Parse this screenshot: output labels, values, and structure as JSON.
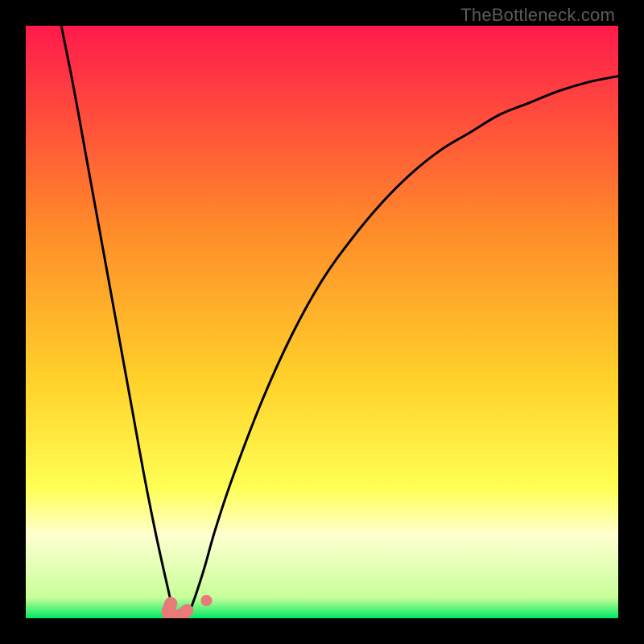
{
  "watermark": "TheBottleneck.com",
  "gradient": {
    "top_color": "#ff1a4b",
    "mid1_color": "#ff8a2a",
    "mid2_color": "#ffd22a",
    "mid3_color": "#ffff55",
    "pale_band": "#ffffd0",
    "bottom_color": "#00e862"
  },
  "marker": {
    "color": "#e87a7a",
    "stroke": "#d86a6a"
  },
  "chart_data": {
    "type": "line",
    "title": "",
    "xlabel": "",
    "ylabel": "",
    "xlim": [
      0,
      100
    ],
    "ylim": [
      0,
      100
    ],
    "grid": false,
    "legend": false,
    "series": [
      {
        "name": "left-curve",
        "x": [
          6,
          8,
          10,
          12,
          14,
          16,
          18,
          20,
          22,
          24,
          25,
          26
        ],
        "y": [
          100,
          90,
          79,
          68,
          57,
          46,
          35,
          24,
          14,
          5,
          1,
          0
        ]
      },
      {
        "name": "right-curve",
        "x": [
          27,
          28,
          30,
          32,
          35,
          40,
          45,
          50,
          55,
          60,
          65,
          70,
          75,
          80,
          85,
          90,
          95,
          100
        ],
        "y": [
          0,
          2,
          8,
          15,
          24,
          37,
          48,
          57,
          64,
          70,
          75,
          79,
          82,
          85,
          87,
          89,
          90.5,
          91.5
        ]
      }
    ],
    "marker_points": [
      {
        "x": 24.5,
        "y": 2.5
      },
      {
        "x": 24.0,
        "y": 1.2
      },
      {
        "x": 24.2,
        "y": 0.4
      },
      {
        "x": 25.2,
        "y": 0.3
      },
      {
        "x": 26.3,
        "y": 0.5
      },
      {
        "x": 27.2,
        "y": 1.3
      },
      {
        "x": 30.5,
        "y": 3.0
      }
    ],
    "background_gradient_stops": [
      {
        "pos": 0.0,
        "color": "#ff1a4b"
      },
      {
        "pos": 0.34,
        "color": "#ff8a2a"
      },
      {
        "pos": 0.6,
        "color": "#ffd22a"
      },
      {
        "pos": 0.78,
        "color": "#ffff55"
      },
      {
        "pos": 0.86,
        "color": "#ffffd0"
      },
      {
        "pos": 0.965,
        "color": "#c8ff9a"
      },
      {
        "pos": 1.0,
        "color": "#00e862"
      }
    ]
  }
}
